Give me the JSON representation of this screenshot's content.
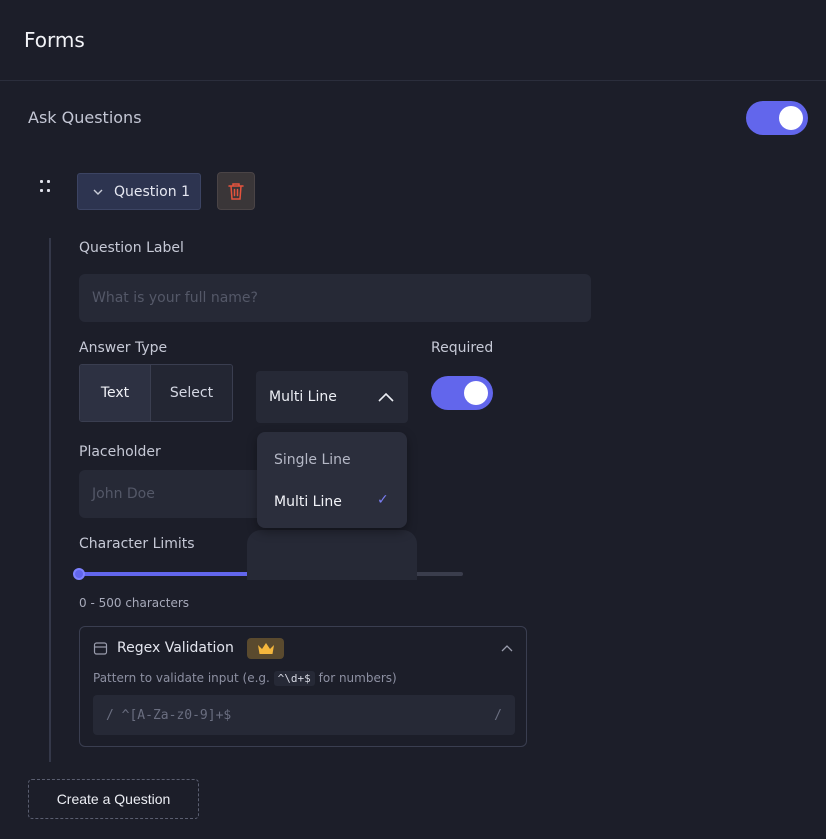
{
  "header": {
    "title": "Forms"
  },
  "ask_questions": {
    "label": "Ask Questions",
    "enabled": true
  },
  "question": {
    "chip_label": "Question 1",
    "label_title": "Question Label",
    "label_placeholder": "What is your full name?",
    "answer_type": {
      "title": "Answer Type",
      "options": [
        "Text",
        "Select"
      ],
      "selected": "Text"
    },
    "line_select": {
      "value": "Multi Line",
      "options": [
        "Single Line",
        "Multi Line"
      ],
      "selected": "Multi Line"
    },
    "required": {
      "title": "Required",
      "enabled": true
    },
    "placeholder": {
      "title": "Placeholder",
      "value": "John Doe"
    },
    "character_limits": {
      "title": "Character Limits",
      "text": "0 - 500 characters",
      "min_fraction": 0,
      "max_fraction": 0.487
    },
    "regex": {
      "title": "Regex Validation",
      "hint_prefix": "Pattern to validate input (e.g.",
      "hint_code": "^\\d+$",
      "hint_suffix": "for numbers)",
      "delimiter_start": "/",
      "placeholder": "^[A-Za-z0-9]+$",
      "delimiter_end": "/"
    }
  },
  "create_button": "Create a Question",
  "colors": {
    "accent": "#6266ec",
    "background": "#1c1e29",
    "danger": "#e5533d",
    "premium": "#f4b63d"
  }
}
